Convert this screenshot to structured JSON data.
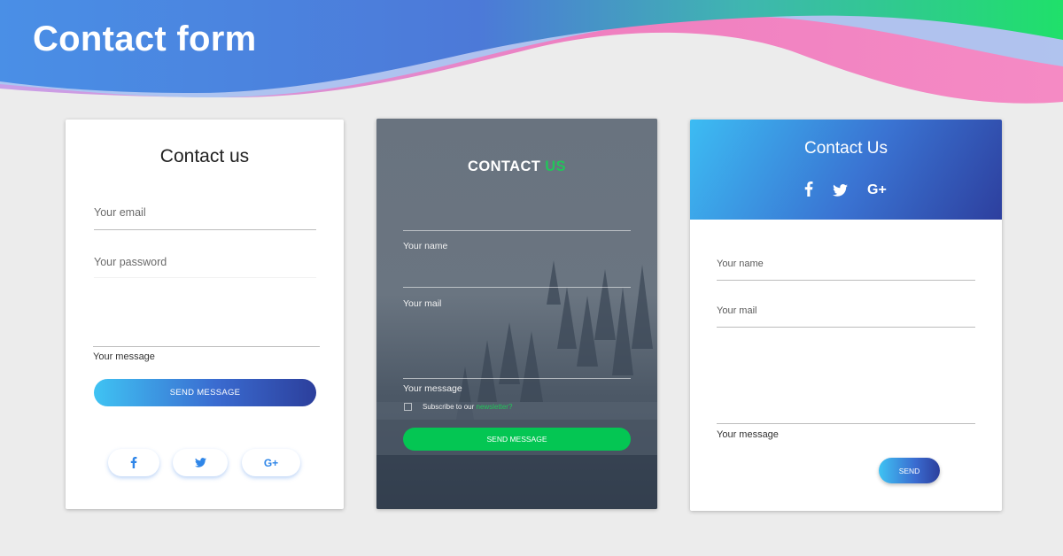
{
  "page": {
    "title": "Contact form"
  },
  "colors": {
    "blue": "#3a73d2",
    "green": "#04c653",
    "pink": "#f082c0"
  },
  "card1": {
    "title": "Contact us",
    "email_placeholder": "Your email",
    "password_placeholder": "Your password",
    "message_label": "Your message",
    "send_label": "SEND MESSAGE",
    "social": [
      "facebook-icon",
      "twitter-icon",
      "google-plus-icon"
    ]
  },
  "card2": {
    "title_part1": "CONTACT",
    "title_part2": "US",
    "name_label": "Your name",
    "mail_label": "Your mail",
    "message_label": "Your message",
    "subscribe_text": "Subscribe to our",
    "subscribe_link": "newsletter?",
    "send_label": "SEND MESSAGE"
  },
  "card3": {
    "title": "Contact Us",
    "name_label": "Your name",
    "mail_label": "Your mail",
    "message_label": "Your message",
    "send_label": "SEND",
    "social": [
      "facebook-icon",
      "twitter-icon",
      "google-plus-icon"
    ]
  }
}
